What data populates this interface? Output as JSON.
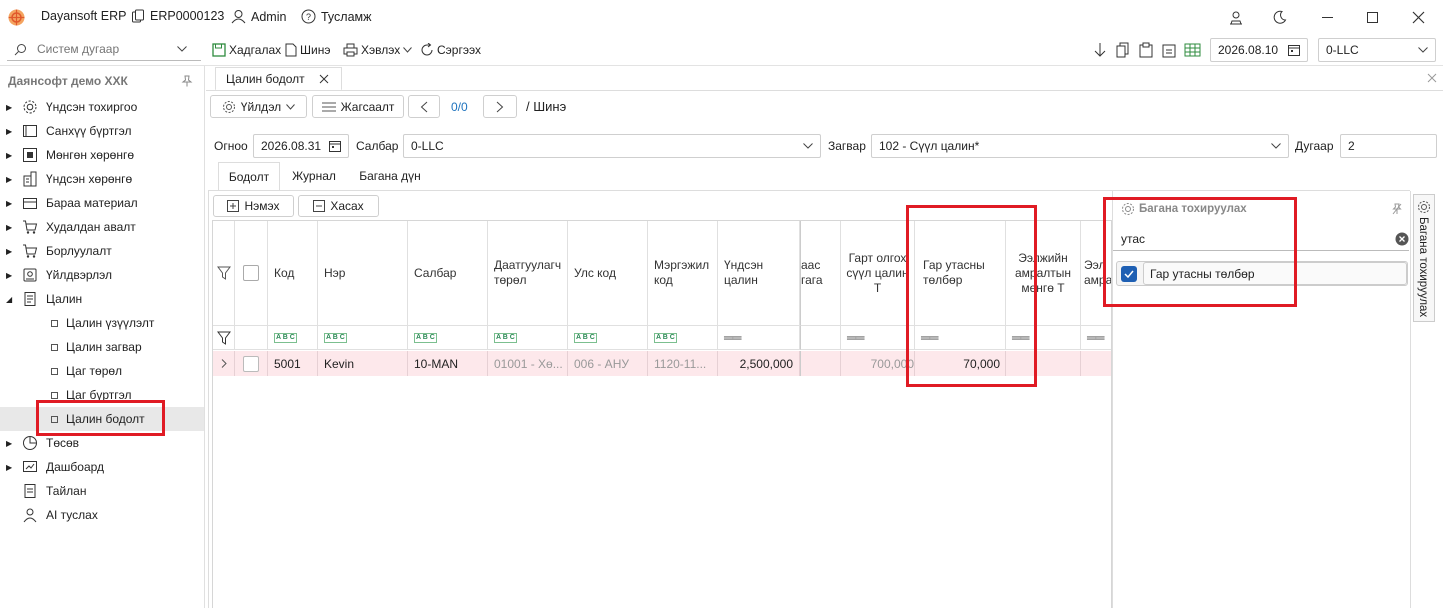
{
  "app": {
    "name": "Dayansoft ERP",
    "db": "ERP0000123",
    "user": "Admin",
    "help": "Тусламж"
  },
  "toolbar": {
    "search_placeholder": "Систем дугаар",
    "save": "Хадгалах",
    "new": "Шинэ",
    "print": "Хэвлэх",
    "refresh": "Сэргээх",
    "date": "2026.08.10",
    "company": "0-LLC"
  },
  "sidebar": {
    "company": "Даянсофт демо ХХК",
    "items": [
      {
        "label": "Үндсэн тохиргоо",
        "icon": "gear-icon"
      },
      {
        "label": "Санхүү бүртгэл",
        "icon": "ledger-icon"
      },
      {
        "label": "Мөнгөн хөрөнгө",
        "icon": "money-icon"
      },
      {
        "label": "Үндсэн хөрөнгө",
        "icon": "building-icon"
      },
      {
        "label": "Бараа материал",
        "icon": "box-icon"
      },
      {
        "label": "Худалдан авалт",
        "icon": "cart-icon"
      },
      {
        "label": "Борлуулалт",
        "icon": "sale-cart-icon"
      },
      {
        "label": "Үйлдвэрлэл",
        "icon": "factory-icon"
      },
      {
        "label": "Цалин",
        "icon": "document-icon"
      }
    ],
    "payroll_children": [
      "Цалин үзүүлэлт",
      "Цалин загвар",
      "Цаг төрөл",
      "Цаг бүртгэл",
      "Цалин бодолт"
    ],
    "after": [
      {
        "label": "Төсөв",
        "icon": "pie-chart-icon"
      },
      {
        "label": "Дашбоард",
        "icon": "dashboard-icon"
      },
      {
        "label": "Тайлан",
        "icon": "report-icon"
      },
      {
        "label": "AI туслах",
        "icon": "ai-assistant-icon"
      }
    ]
  },
  "doc_tab": "Цалин бодолт",
  "actions": {
    "operation": "Үйлдэл",
    "list": "Жагсаалт",
    "counter": "0/0",
    "mode": "/ Шинэ"
  },
  "form": {
    "date_label": "Огноо",
    "date": "2026.08.31",
    "branch_label": "Салбар",
    "branch": "0-LLC",
    "template_label": "Загвар",
    "template": "102 - Сүүл цалин*",
    "number_label": "Дугаар",
    "number": "2"
  },
  "subtabs": [
    "Бодолт",
    "Журнал",
    "Багана дүн"
  ],
  "grid_buttons": {
    "add": "Нэмэх",
    "remove": "Хасах"
  },
  "columns": [
    "Код",
    "Нэр",
    "Салбар",
    "Даатгуулагч төрөл",
    "Улс код",
    "Мэргэжил код",
    "Үндсэн цалин",
    "аас гага",
    "Гарт олгох сүүл цалин Т",
    "Гар утасны төлбөр",
    "Ээлжийн амралтын мөнгө Т",
    "Ээл амра"
  ],
  "row": {
    "code": "5001",
    "name": "Kevin",
    "branch": "10-MAN",
    "insured_type": "01001 - Хө...",
    "country": "006 - АНУ",
    "profession": "1120-11...",
    "base_salary": "2,500,000",
    "net_final": "700,000",
    "phone_fee": "70,000"
  },
  "column_panel": {
    "title": "Багана тохируулах",
    "search": "утас",
    "option": "Гар утасны төлбөр",
    "checked": true,
    "side_tab": "Багана тохируулах"
  }
}
